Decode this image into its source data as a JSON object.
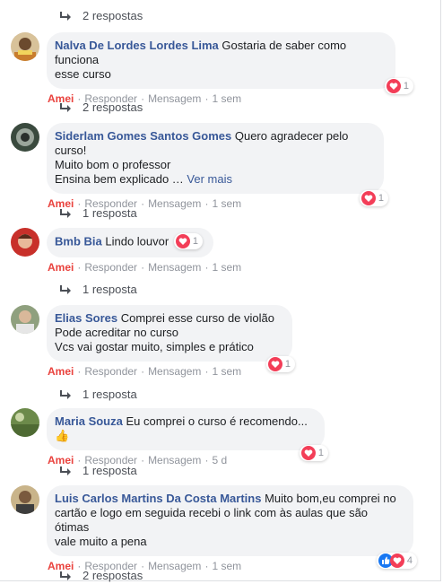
{
  "thread": [
    {
      "type": "replies",
      "label": "2 respostas"
    },
    {
      "type": "comment",
      "author": "Nalva De Lordes Lordes Lima",
      "lines": [
        "Gostaria de saber como funciona",
        "esse curso"
      ],
      "reactions": "1",
      "time": "1 sem"
    },
    {
      "type": "replies",
      "label": "2 respostas"
    },
    {
      "type": "comment",
      "author": "Siderlam Gomes Santos Gomes",
      "lines": [
        "Quero agradecer pelo curso!",
        "Muito bom o professor",
        "Ensina bem explicado … "
      ],
      "more": "Ver mais",
      "reactions": "1",
      "time": "1 sem"
    },
    {
      "type": "replies",
      "label": "1 resposta"
    },
    {
      "type": "comment",
      "author": "Bmb Bia",
      "lines": [
        "Lindo louvor"
      ],
      "reactions": "1",
      "time": "1 sem"
    },
    {
      "type": "replies",
      "label": "1 resposta"
    },
    {
      "type": "comment",
      "author": "Elias Sores",
      "lines": [
        "Comprei esse curso de violão",
        "Pode acreditar no curso",
        "Vcs vai gostar muito, simples e prático"
      ],
      "reactions": "1",
      "time": "1 sem"
    },
    {
      "type": "replies",
      "label": "1 resposta"
    },
    {
      "type": "comment",
      "author": "Maria Souza",
      "lines": [
        "Eu comprei o curso é recomendo...👍"
      ],
      "reactions": "1",
      "time": "5 d"
    },
    {
      "type": "replies",
      "label": "1 resposta"
    },
    {
      "type": "comment",
      "author": "Luis Carlos Martins Da Costa Martins",
      "lines": [
        "Muito bom,eu comprei no",
        "cartão e logo em seguida recebi o link com às aulas que são ótimas",
        "vale muito a pena"
      ],
      "reactions": "4",
      "time": "1 sem"
    },
    {
      "type": "replies",
      "label": "2 respostas"
    }
  ],
  "actions": {
    "like": "Amei",
    "reply": "Responder",
    "message": "Mensagem",
    "sep": "·"
  },
  "colors": {
    "author": "#385898",
    "love": "#e9423d",
    "bubble": "#f2f3f5",
    "meta": "#90949c"
  }
}
